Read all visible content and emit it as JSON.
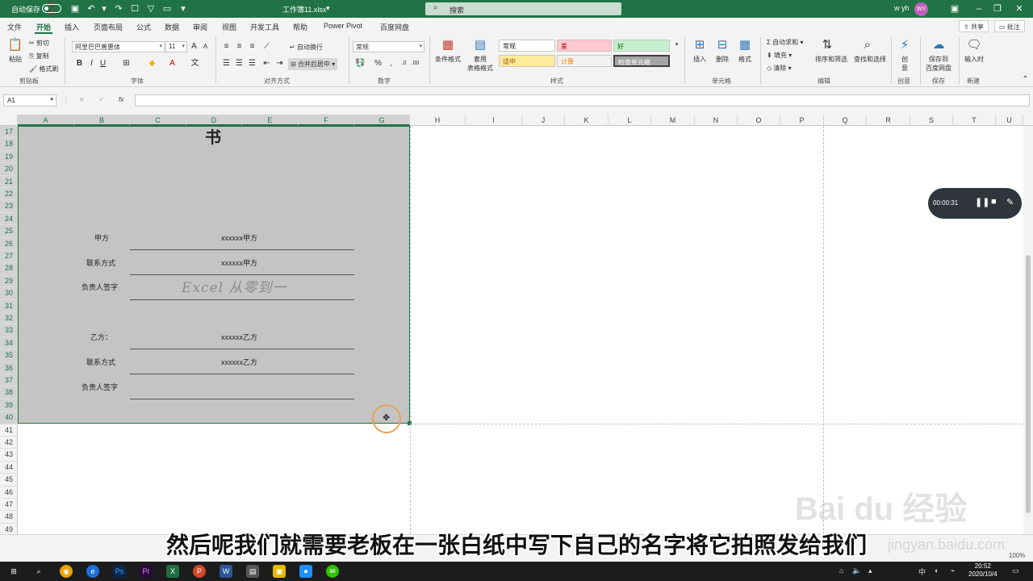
{
  "titlebar": {
    "autosave_label": "自动保存",
    "autosave_state": "关",
    "filename": "工作簿11.xlsx",
    "search_placeholder": "搜索",
    "user": "w yh",
    "avatar": "WY",
    "accent_color": "#217346"
  },
  "menu": {
    "tabs": [
      "文件",
      "开始",
      "插入",
      "页面布局",
      "公式",
      "数据",
      "审阅",
      "视图",
      "开发工具",
      "帮助",
      "Power Pivot",
      "百度网盘"
    ],
    "active_index": 1,
    "share_label": "共享",
    "comment_label": "批注"
  },
  "ribbon": {
    "clipboard": {
      "paste": "粘贴",
      "cut": "剪切",
      "copy": "复制",
      "format_painter": "格式刷",
      "group": "剪贴板"
    },
    "font": {
      "family": "阿里巴巴普惠体",
      "size": "11",
      "group": "字体"
    },
    "alignment": {
      "wrap": "自动换行",
      "merge": "合并后居中",
      "group": "对齐方式"
    },
    "number": {
      "format": "常规",
      "group": "数字"
    },
    "styles": {
      "conditional": "条件格式",
      "table": "套用\n表格格式",
      "cells": [
        "常规",
        "差",
        "好",
        "适中",
        "计算",
        "检查单元格"
      ],
      "group": "样式"
    },
    "cells": {
      "insert": "插入",
      "delete": "删除",
      "format": "格式",
      "group": "单元格"
    },
    "editing": {
      "autosum": "自动求和",
      "fill": "填充",
      "clear": "清除",
      "sort": "排序和筛选",
      "find": "查找和选择",
      "group": "编辑"
    },
    "idea": {
      "label": "创\n意",
      "group": "创意"
    },
    "save": {
      "label": "保存到\n百度网盘",
      "group": "保存"
    },
    "input": {
      "label": "输入时",
      "group": "新建"
    }
  },
  "formula": {
    "namebox": "A1",
    "cancel": "✕",
    "enter": "✓",
    "fx": "fx"
  },
  "columns": [
    "A",
    "B",
    "C",
    "D",
    "E",
    "F",
    "G",
    "H",
    "I",
    "J",
    "K",
    "L",
    "M",
    "N",
    "O",
    "P",
    "Q",
    "R",
    "S",
    "T",
    "U"
  ],
  "rows": [
    "17",
    "18",
    "19",
    "20",
    "21",
    "22",
    "23",
    "24",
    "25",
    "26",
    "27",
    "28",
    "29",
    "30",
    "31",
    "32",
    "33",
    "34",
    "35",
    "36",
    "37",
    "38",
    "39",
    "40",
    "41",
    "42",
    "43",
    "44",
    "45",
    "46",
    "47",
    "48",
    "49"
  ],
  "doc": {
    "title_fragment": "书",
    "party_a_label": "甲方",
    "party_a_value": "xxxxxx甲方",
    "contact_label_a": "联系方式",
    "contact_value_a": "xxxxxx甲方",
    "sign_label_a": "负责人签字",
    "signature": "Excel 从零到一",
    "party_b_label": "乙方：",
    "party_b_value": "xxxxxx乙方",
    "contact_label_b": "联系方式",
    "contact_value_b": "xxxxxx乙方",
    "sign_label_b": "负责人签字"
  },
  "recorder": {
    "time": "00:00:31"
  },
  "status": {
    "zoom": "100%"
  },
  "subtitle": "然后呢我们就需要老板在一张白纸中写下自己的名字将它拍照发给我们",
  "watermark": {
    "brand": "Bai du 经验",
    "url": "jingyan.baidu.com"
  },
  "taskbar": {
    "time": "20:52",
    "date": "2020/10/4"
  }
}
